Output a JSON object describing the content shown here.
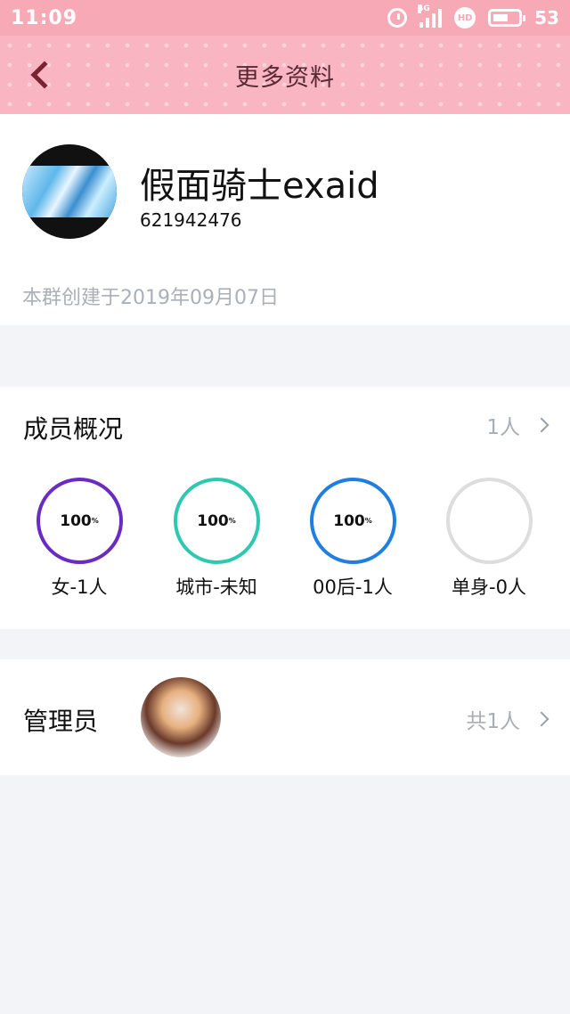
{
  "status_bar": {
    "time": "11:09",
    "network": "4G",
    "hd_badge": "HD",
    "battery": "53"
  },
  "nav": {
    "title": "更多资料"
  },
  "group": {
    "name": "假面骑士exaid",
    "id": "621942476",
    "created_text": "本群创建于2019年09月07日"
  },
  "members": {
    "title": "成员概况",
    "count": "1人",
    "stats": [
      {
        "percent": "100",
        "unit": "%",
        "label": "女-1人",
        "color": "#6a2bc2"
      },
      {
        "percent": "100",
        "unit": "%",
        "label": "城市-未知",
        "color": "#2ec8b0"
      },
      {
        "percent": "100",
        "unit": "%",
        "label": "00后-1人",
        "color": "#1e7fe0"
      },
      {
        "percent": "",
        "unit": "",
        "label": "单身-0人",
        "color": "#dddddd"
      }
    ]
  },
  "admins": {
    "title": "管理员",
    "count": "共1人"
  }
}
